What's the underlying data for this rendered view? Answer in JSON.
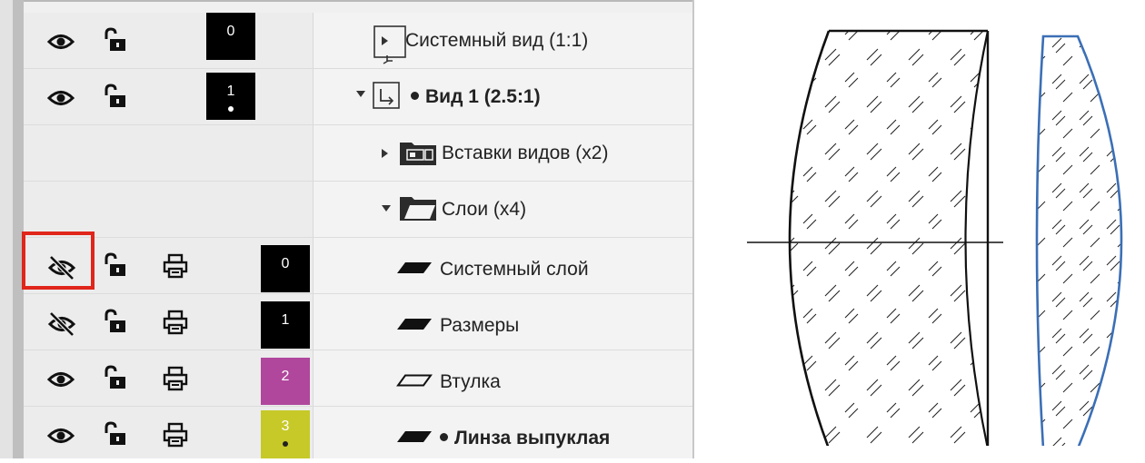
{
  "views": [
    {
      "visible": true,
      "locked": false,
      "number": "0",
      "swatch_color": "#000000",
      "has_dot": false,
      "expanded": false,
      "label": "Системный вид (1:1)",
      "bold": false,
      "current": false
    },
    {
      "visible": true,
      "locked": false,
      "number": "1",
      "swatch_color": "#000000",
      "has_dot": true,
      "expanded": true,
      "label": "Вид 1 (2.5:1)",
      "bold": true,
      "current": true
    }
  ],
  "groups": [
    {
      "icon": "view-inserts-folder-icon",
      "expanded": false,
      "label": "Вставки видов (x2)"
    },
    {
      "icon": "folder-icon",
      "expanded": true,
      "label": "Слои (x4)"
    }
  ],
  "layers": [
    {
      "visible": false,
      "locked": false,
      "printable": true,
      "number": "0",
      "swatch_color": "#000000",
      "has_dot": false,
      "filled": true,
      "label": "Системный слой",
      "bold": false,
      "current": false
    },
    {
      "visible": false,
      "locked": false,
      "printable": true,
      "number": "1",
      "swatch_color": "#000000",
      "has_dot": false,
      "filled": true,
      "label": "Размеры",
      "bold": false,
      "current": false
    },
    {
      "visible": true,
      "locked": false,
      "printable": true,
      "number": "2",
      "swatch_color": "#b0479c",
      "has_dot": false,
      "filled": false,
      "label": "Втулка",
      "bold": false,
      "current": false
    },
    {
      "visible": true,
      "locked": false,
      "printable": true,
      "number": "3",
      "swatch_color": "#c7c928",
      "has_dot": true,
      "filled": true,
      "label": "Линза выпуклая",
      "bold": true,
      "current": true
    }
  ],
  "highlight_target": "layer-visibility-toggle-0",
  "colors": {
    "highlight": "#e0251b",
    "lens_outline": "#000000",
    "selected_lens_outline": "#3b6fb6"
  }
}
